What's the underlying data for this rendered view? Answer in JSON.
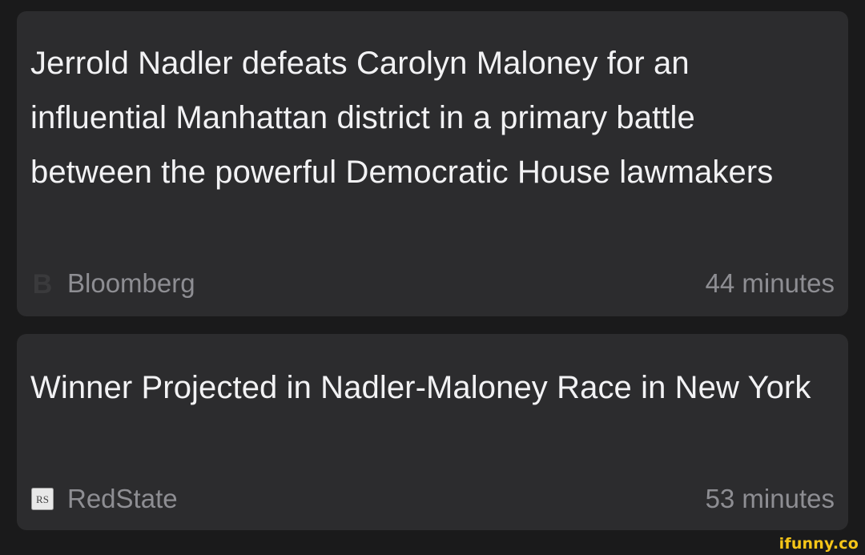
{
  "articles": [
    {
      "headline": "Jerrold Nadler defeats Carolyn Maloney for an influential Manhattan district in a primary battle between the powerful Democratic House lawmakers",
      "source": "Bloomberg",
      "source_icon": "bloomberg-b-icon",
      "time": "44 minutes"
    },
    {
      "headline": "Winner Projected in Nadler-Maloney Race in New York",
      "source": "RedState",
      "source_icon": "redstate-rs-icon",
      "time": "53 minutes"
    }
  ],
  "watermark": "ifunny.co",
  "colors": {
    "background": "#1a1a1b",
    "card": "#2c2c2e",
    "headline_text": "#f2f2f4",
    "meta_text": "#8e8e93",
    "watermark": "#f5c518"
  }
}
